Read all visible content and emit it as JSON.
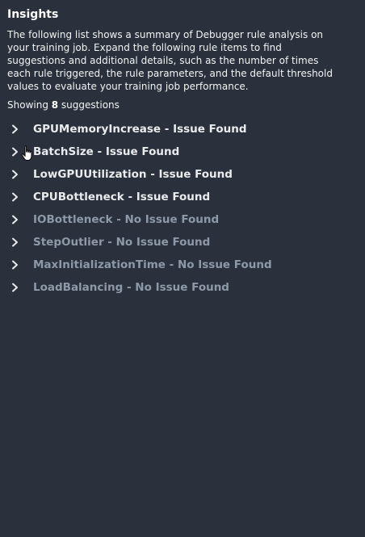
{
  "insights": {
    "title": "Insights",
    "description": "The following list shows a summary of Debugger rule analysis on your training job. Expand the following rule items to find suggestions and additional details, such as the number of times each rule triggered, the rule parameters, and the default threshold values to evaluate your training job performance.",
    "showing_prefix": "Showing ",
    "showing_count": "8",
    "showing_suffix": " suggestions",
    "rules": [
      {
        "label": "GPUMemoryIncrease - Issue Found",
        "status": "issue"
      },
      {
        "label": "BatchSize - Issue Found",
        "status": "issue"
      },
      {
        "label": "LowGPUUtilization - Issue Found",
        "status": "issue"
      },
      {
        "label": "CPUBottleneck - Issue Found",
        "status": "issue"
      },
      {
        "label": "IOBottleneck - No Issue Found",
        "status": "no-issue"
      },
      {
        "label": "StepOutlier - No Issue Found",
        "status": "no-issue"
      },
      {
        "label": "MaxInitializationTime - No Issue Found",
        "status": "no-issue"
      },
      {
        "label": "LoadBalancing - No Issue Found",
        "status": "no-issue"
      }
    ]
  },
  "colors": {
    "background": "#2a313c",
    "issue_text": "#e9ebed",
    "no_issue_text": "#8d99a8"
  },
  "icons": {
    "expand": "chevron-right-icon",
    "pointer": "hand-pointer-cursor-icon"
  }
}
